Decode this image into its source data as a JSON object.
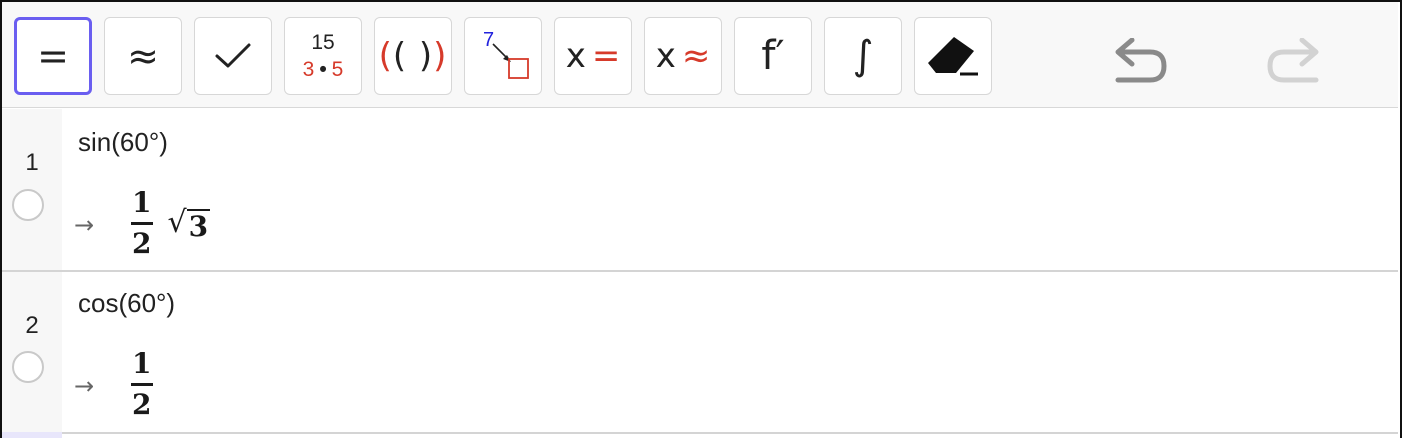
{
  "toolbar": {
    "buttons": [
      {
        "name": "evaluate-button",
        "symbol": "=",
        "selected": true
      },
      {
        "name": "numeric-button",
        "symbol": "≈"
      },
      {
        "name": "keep-input-button",
        "symbol": "✓"
      },
      {
        "name": "factor-button",
        "top": "15",
        "bottom_left": "3",
        "bottom_dot": "•",
        "bottom_right": "5"
      },
      {
        "name": "expand-button",
        "left_paren": "(",
        "inner": "( )",
        "right_paren": ")"
      },
      {
        "name": "substitute-button",
        "number": "7"
      },
      {
        "name": "solve-button",
        "var": "x",
        "op": "="
      },
      {
        "name": "nsolve-button",
        "var": "x",
        "op": "≈"
      },
      {
        "name": "derivative-button",
        "symbol": "f′"
      },
      {
        "name": "integral-button",
        "symbol": "∫"
      },
      {
        "name": "delete-button",
        "icon": "eraser-icon"
      }
    ],
    "undo_icon": "undo-icon",
    "redo_icon": "redo-icon",
    "accent_color": "#6a5ef0",
    "red_color": "#d63a2a"
  },
  "rows": [
    {
      "number": "1",
      "input": "sin(60°)",
      "arrow": "→",
      "result": {
        "numerator": "1",
        "denominator": "2",
        "sqrt_radicand": "3"
      }
    },
    {
      "number": "2",
      "input": "cos(60°)",
      "arrow": "→",
      "result": {
        "numerator": "1",
        "denominator": "2"
      }
    }
  ]
}
